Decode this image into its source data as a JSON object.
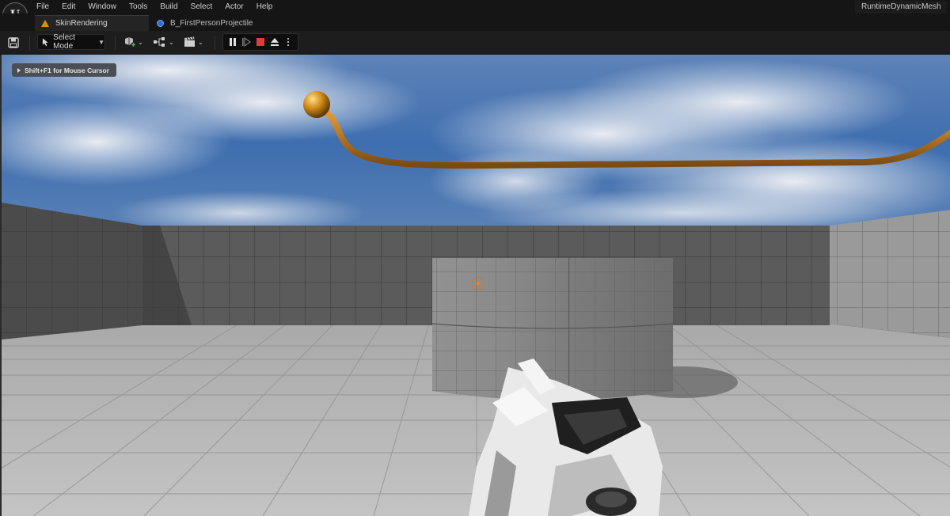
{
  "menu": {
    "items": [
      "File",
      "Edit",
      "Window",
      "Tools",
      "Build",
      "Select",
      "Actor",
      "Help"
    ],
    "project_name": "RuntimeDynamicMesh"
  },
  "tabs": {
    "active": "SkinRendering",
    "inactive": "B_FirstPersonProjectile"
  },
  "toolbar": {
    "select_mode_label": "Select Mode"
  },
  "viewport": {
    "hint_text": "Shift+F1 for Mouse Cursor"
  },
  "colors": {
    "accent_orange": "#e38a12",
    "stop_red": "#e23b3b",
    "blueprint_blue": "#2f6fd6"
  }
}
